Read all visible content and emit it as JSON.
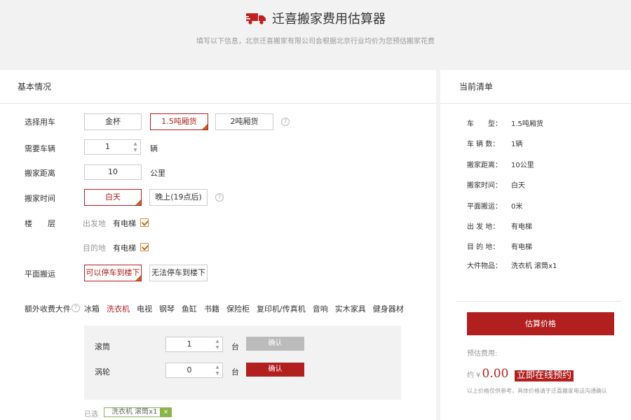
{
  "header": {
    "title": "迁喜搬家费用估算器",
    "subtitle": "填写以下信息，北京迁喜搬家有限公司会根据北京行业均价为您预估搬家花费",
    "icon": "truck-icon",
    "icon_color": "#c0201f"
  },
  "form": {
    "section_title": "基本情况",
    "vehicle": {
      "label": "选择用车",
      "options": [
        "金杯",
        "1.5吨厢货",
        "2吨厢货"
      ],
      "selected": "1.5吨厢货"
    },
    "vehicle_count": {
      "label": "需要车辆",
      "value": "1",
      "unit": "辆"
    },
    "distance": {
      "label": "搬家距离",
      "value": "10",
      "unit": "公里"
    },
    "time": {
      "label": "搬家时间",
      "options": [
        "白天",
        "晚上(19点后)"
      ],
      "selected": "白天"
    },
    "floor": {
      "label": "楼　　层",
      "from_label": "出发地",
      "from_elevator": "有电梯",
      "from_checked": true,
      "to_label": "目的地",
      "to_elevator": "有电梯",
      "to_checked": true
    },
    "flat_move": {
      "label": "平面搬运",
      "options": [
        "可以停车到楼下",
        "无法停车到楼下"
      ],
      "selected": "可以停车到楼下"
    },
    "extra": {
      "label": "额外收费大件",
      "tabs": [
        "冰箱",
        "洗衣机",
        "电视",
        "钢琴",
        "鱼缸",
        "书籍",
        "保险柜",
        "复印机/传真机",
        "音响",
        "实木家具",
        "健身器材"
      ],
      "active_tab": "洗衣机",
      "items": [
        {
          "name": "滚筒",
          "value": "1",
          "unit": "台",
          "button": "确认"
        },
        {
          "name": "涡轮",
          "value": "0",
          "unit": "台",
          "button": "确认"
        }
      ],
      "chosen_label": "已选",
      "chosen_tag": "洗衣机 滚筒x1",
      "remove_symbol": "×"
    }
  },
  "summary": {
    "section_title": "当前清单",
    "rows": [
      {
        "key": "车　　型：",
        "value": "1.5吨厢货"
      },
      {
        "key": "车 辆 数：",
        "value": "1辆"
      },
      {
        "key": "搬家距离：",
        "value": "10公里"
      },
      {
        "key": "搬家时间：",
        "value": "白天"
      },
      {
        "key": "平面搬运：",
        "value": "0米"
      },
      {
        "key": "出 发 地：",
        "value": "有电梯"
      },
      {
        "key": "目 的 地：",
        "value": "有电梯"
      },
      {
        "key": "大件物品：",
        "value": "洗衣机 滚筒x1"
      }
    ],
    "estimate_button": "估算价格",
    "estimate_label": "预估费用:",
    "price_prefix": "约 ¥",
    "price": "0.00",
    "book_link": "立即在线预约",
    "disclaimer": "以上价格仅供参考，具体价格请于迁喜搬家电话沟通确认"
  },
  "colors": {
    "accent": "#b21f1f",
    "tag_green": "#8ab349"
  }
}
